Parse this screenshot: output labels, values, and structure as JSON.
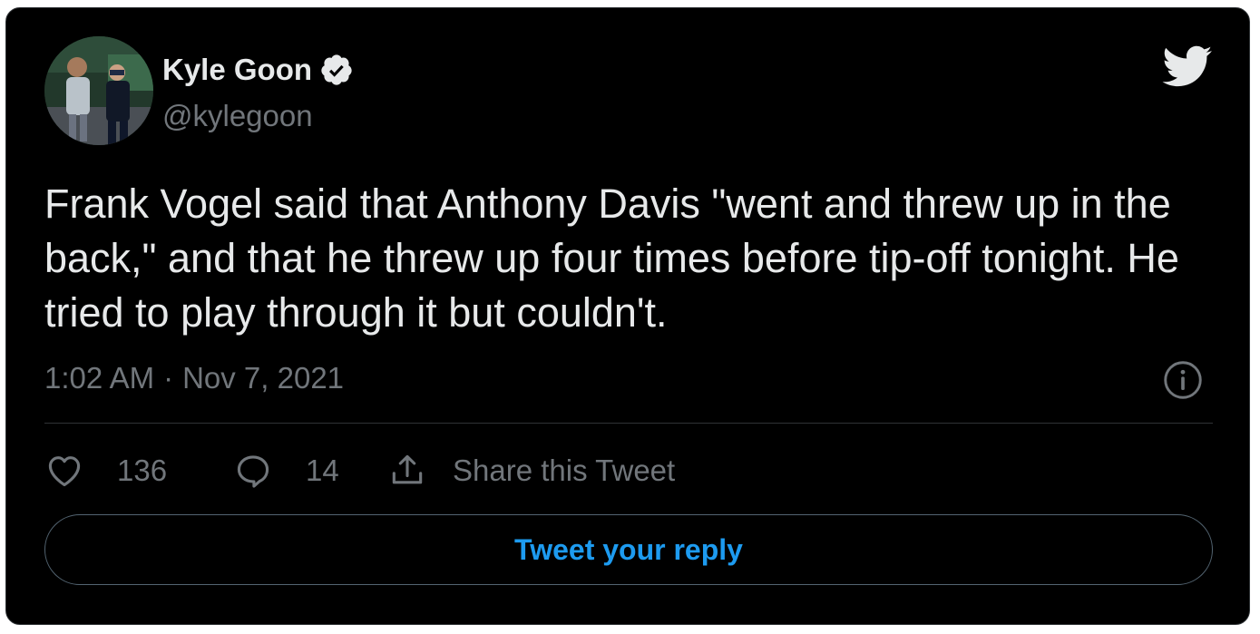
{
  "author": {
    "name": "Kyle Goon",
    "handle": "@kylegoon",
    "verified": true,
    "avatar_icon": "avatar-photo"
  },
  "tweet": {
    "text": "Frank Vogel said that Anthony Davis \"went and threw up in the back,\" and that he threw up four times before tip-off tonight. He tried to play through it but couldn't.",
    "time": "1:02 AM",
    "separator": "·",
    "date": "Nov 7, 2021"
  },
  "actions": {
    "likes": "136",
    "replies": "14",
    "share_label": "Share this Tweet"
  },
  "reply_prompt": "Tweet your reply",
  "icons": {
    "brand": "twitter-bird-icon",
    "verified": "verified-badge-icon",
    "info": "info-icon",
    "like": "heart-icon",
    "reply": "reply-bubble-icon",
    "share": "share-icon"
  },
  "colors": {
    "background": "#000000",
    "text": "#e7e9ea",
    "muted": "#71767b",
    "accent": "#1d9bf0",
    "border": "#2f3336"
  }
}
